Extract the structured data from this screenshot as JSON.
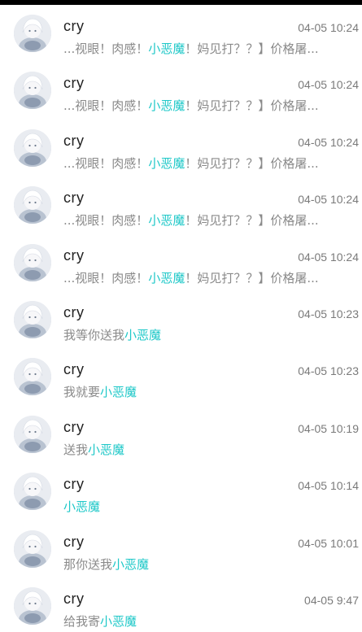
{
  "messages": [
    {
      "name": "cry",
      "time": "04-05 10:24",
      "pre": "...视眼！肉感！",
      "keyword": "小恶魔",
      "post": "！妈见打？？】价格屠..."
    },
    {
      "name": "cry",
      "time": "04-05 10:24",
      "pre": "...视眼！肉感！",
      "keyword": "小恶魔",
      "post": "！妈见打？？】价格屠..."
    },
    {
      "name": "cry",
      "time": "04-05 10:24",
      "pre": "...视眼！肉感！",
      "keyword": "小恶魔",
      "post": "！妈见打？？】价格屠..."
    },
    {
      "name": "cry",
      "time": "04-05 10:24",
      "pre": "...视眼！肉感！",
      "keyword": "小恶魔",
      "post": "！妈见打？？】价格屠..."
    },
    {
      "name": "cry",
      "time": "04-05 10:24",
      "pre": "...视眼！肉感！",
      "keyword": "小恶魔",
      "post": "！妈见打？？】价格屠..."
    },
    {
      "name": "cry",
      "time": "04-05 10:23",
      "pre": "我等你送我",
      "keyword": "小恶魔",
      "post": ""
    },
    {
      "name": "cry",
      "time": "04-05 10:23",
      "pre": "我就要",
      "keyword": "小恶魔",
      "post": ""
    },
    {
      "name": "cry",
      "time": "04-05 10:19",
      "pre": "送我",
      "keyword": "小恶魔",
      "post": ""
    },
    {
      "name": "cry",
      "time": "04-05 10:14",
      "pre": "",
      "keyword": "小恶魔",
      "post": ""
    },
    {
      "name": "cry",
      "time": "04-05 10:01",
      "pre": "那你送我",
      "keyword": "小恶魔",
      "post": ""
    },
    {
      "name": "cry",
      "time": "04-05 9:47",
      "pre": "给我寄",
      "keyword": "小恶魔",
      "post": ""
    }
  ],
  "colors": {
    "keyword": "#1ec8c8",
    "name": "#222222",
    "time": "#7a7a7a",
    "text": "#8a8a8a"
  },
  "icons": {
    "avatar": "avatar-icon"
  }
}
